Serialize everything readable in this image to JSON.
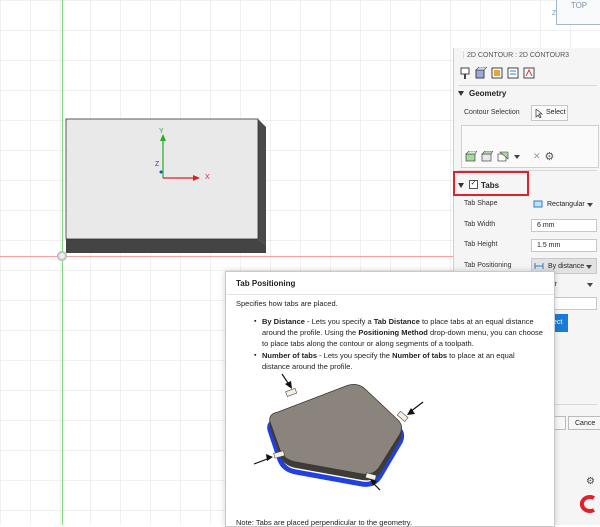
{
  "view": {
    "cube_label": "TOP",
    "axis_x": "X",
    "axis_y": "Y",
    "axis_z": "Z",
    "cube_z": "Z"
  },
  "panel": {
    "title": "2D CONTOUR : 2D CONTOUR3",
    "geometry": {
      "header": "Geometry",
      "contour_selection_label": "Contour Selection",
      "select_label": "Select"
    },
    "tabs": {
      "header": "Tabs",
      "checked": true,
      "tab_shape_label": "Tab Shape",
      "tab_shape_value": "Rectangular",
      "tab_width_label": "Tab Width",
      "tab_width_value": "6 mm",
      "tab_height_label": "Tab Height",
      "tab_height_value": "1.5 mm",
      "tab_positioning_label": "Tab Positioning",
      "tab_positioning_value": "By distance",
      "partial_dropdown": "our",
      "partial_field": "n",
      "select_button_partial": "elect"
    },
    "cancel_partial": "Cance"
  },
  "tooltip": {
    "title": "Tab Positioning",
    "subtitle": "Specifies how tabs are placed.",
    "bullets": [
      {
        "t1": "By Distance",
        "t2": " - Lets you specify a ",
        "t3": "Tab Distance",
        "t4": " to place tabs at an equal distance around the profile. Using the ",
        "t5": "Positioning Method",
        "t6": " drop-down menu, you can choose to place tabs along the contour or along segments of a toolpath."
      },
      {
        "t1": "Number of tabs",
        "t2": " - Lets you specify the ",
        "t3": "Number of tabs",
        "t4": " to place at an equal distance around the profile."
      }
    ],
    "note": "Note: Tabs are placed perpendicular to the geometry."
  },
  "colors": {
    "highlight_red": "#e0202a",
    "accent_blue": "#1a7bd8",
    "axis_x_red": "#e02020",
    "axis_y_green": "#20b020",
    "part_outline_blue": "#2040e0"
  }
}
